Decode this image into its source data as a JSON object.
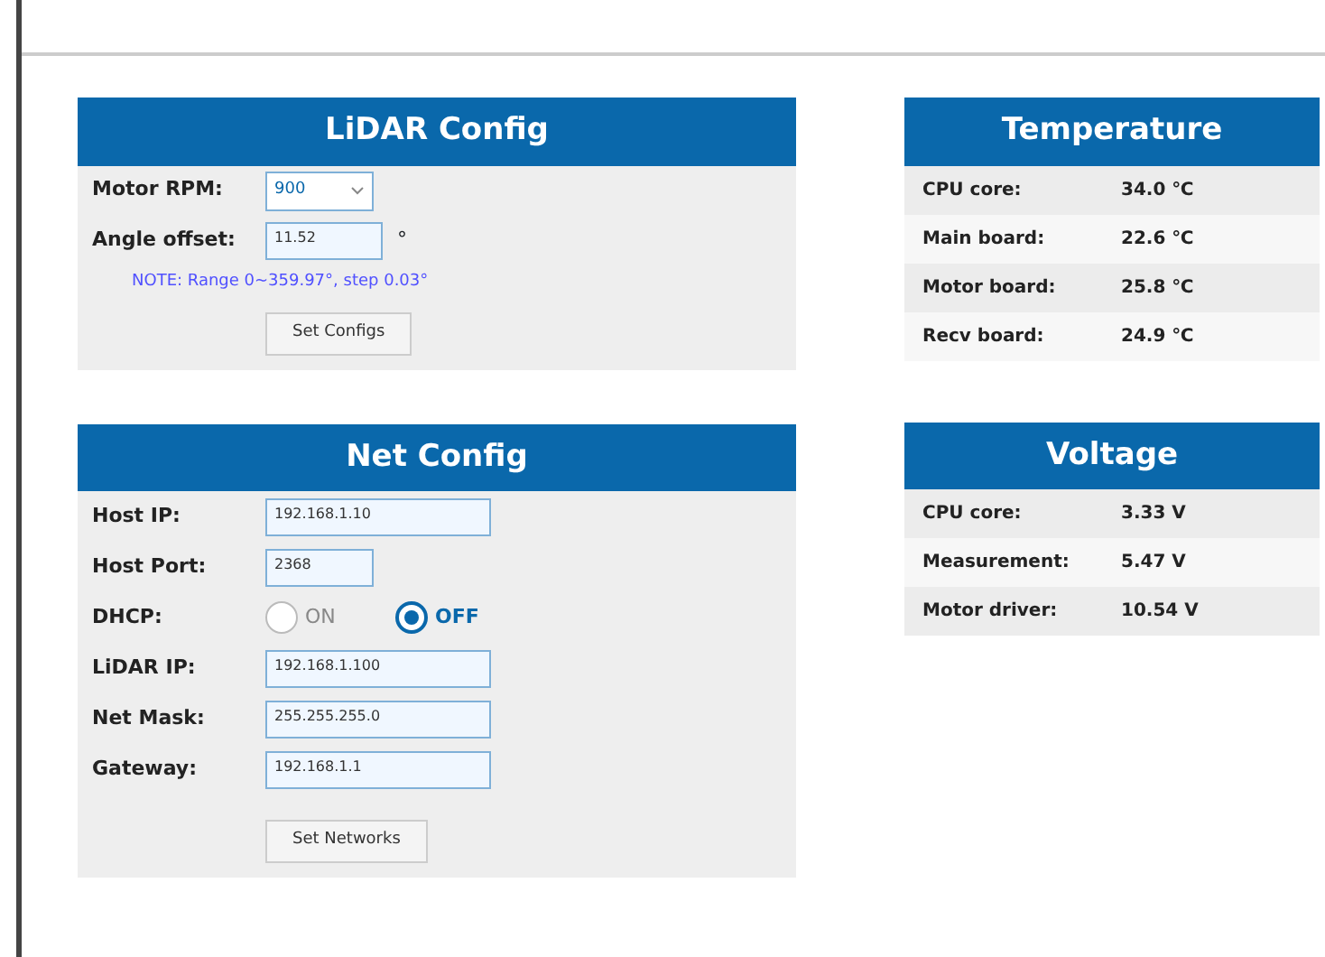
{
  "lidar_config": {
    "title": "LiDAR Config",
    "fields": [
      {
        "kind": "select",
        "label": "Motor RPM:",
        "value": "900"
      },
      {
        "kind": "input",
        "label": "Angle offset:",
        "value": "11.52",
        "unit": "°"
      }
    ],
    "note": "NOTE: Range 0~359.97°, step 0.03°",
    "button": "Set Configs"
  },
  "net_config": {
    "title": "Net Config",
    "fields": [
      {
        "kind": "input",
        "label": "Host IP:",
        "value": "192.168.1.10",
        "wide": true
      },
      {
        "kind": "input",
        "label": "Host Port:",
        "value": "2368",
        "wide": false
      },
      {
        "kind": "radio",
        "label": "DHCP:",
        "options": [
          {
            "label": "ON",
            "selected": false
          },
          {
            "label": "OFF",
            "selected": true
          }
        ]
      },
      {
        "kind": "input",
        "label": "LiDAR IP:",
        "value": "192.168.1.100",
        "wide": true
      },
      {
        "kind": "input",
        "label": "Net Mask:",
        "value": "255.255.255.0",
        "wide": true
      },
      {
        "kind": "input",
        "label": "Gateway:",
        "value": "192.168.1.1",
        "wide": true
      }
    ],
    "button": "Set Networks"
  },
  "temperature": {
    "title": "Temperature",
    "rows": [
      {
        "label": "CPU core:",
        "value": "34.0 ℃"
      },
      {
        "label": "Main board:",
        "value": "22.6 ℃"
      },
      {
        "label": "Motor board:",
        "value": "25.8 ℃"
      },
      {
        "label": "Recv board:",
        "value": "24.9 ℃"
      }
    ]
  },
  "voltage": {
    "title": "Voltage",
    "rows": [
      {
        "label": "CPU core:",
        "value": "3.33 V"
      },
      {
        "label": "Measurement:",
        "value": "5.47 V"
      },
      {
        "label": "Motor driver:",
        "value": "10.54 V"
      }
    ]
  }
}
